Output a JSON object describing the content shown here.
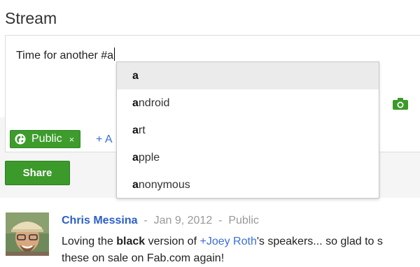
{
  "stream": {
    "title": "Stream"
  },
  "composer": {
    "text": "Time for another #a"
  },
  "autocomplete": {
    "items": [
      {
        "prefix": "a",
        "rest": ""
      },
      {
        "prefix": "a",
        "rest": "ndroid"
      },
      {
        "prefix": "a",
        "rest": "rt"
      },
      {
        "prefix": "a",
        "rest": "pple"
      },
      {
        "prefix": "a",
        "rest": "nonymous"
      }
    ]
  },
  "share": {
    "chip_label": "Public",
    "chip_close": "×",
    "add_label": "+ A",
    "button_label": "Share"
  },
  "post": {
    "author": "Chris Messina",
    "date": "Jan 9, 2012",
    "visibility": "Public",
    "separator": "-",
    "line1_a": "Loving the ",
    "line1_bold": "black",
    "line1_b": " version of ",
    "mention_plus": "+",
    "mention_name": "Joey Roth",
    "line1_c": "'s speakers... so glad to s",
    "line2": "these on sale on Fab.com again!"
  },
  "colors": {
    "green": "#3b9a2a",
    "link": "#3a6fd8",
    "author": "#2b5fc8"
  }
}
